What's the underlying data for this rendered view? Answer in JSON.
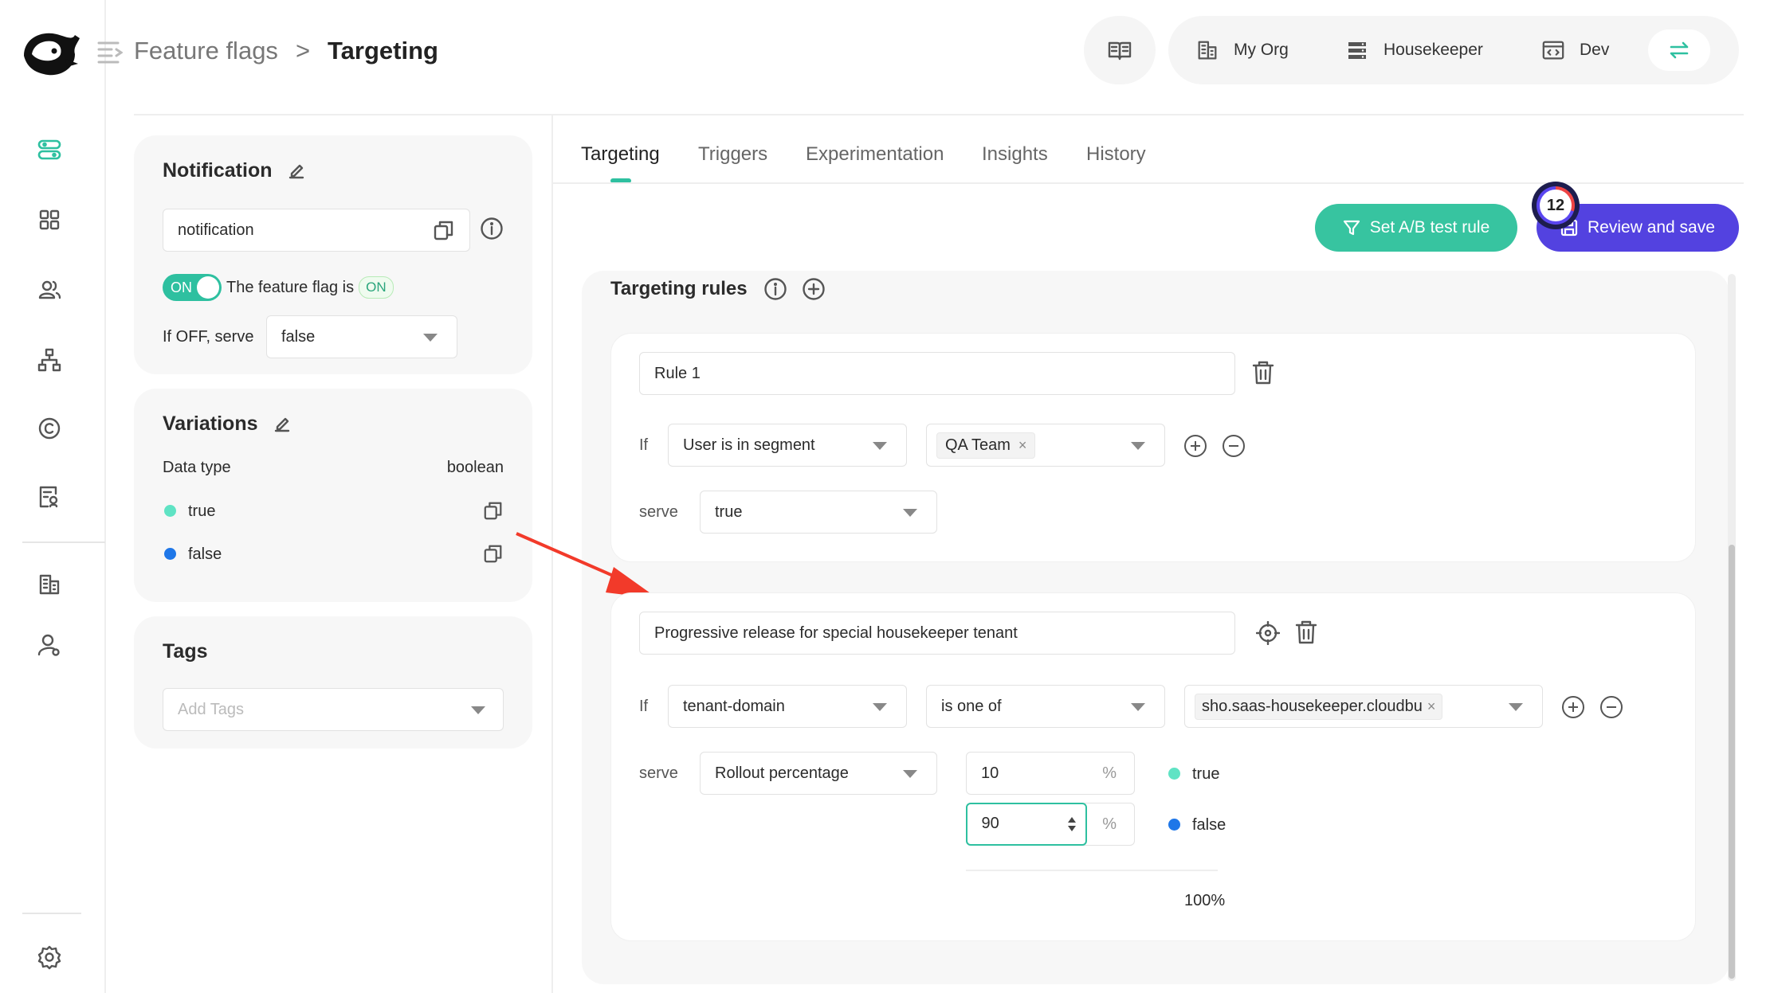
{
  "header": {
    "breadcrumb_parent": "Feature flags",
    "breadcrumb_sep": ">",
    "breadcrumb_current": "Targeting",
    "org": "My Org",
    "project": "Housekeeper",
    "environment": "Dev"
  },
  "sidebar": {
    "icons": [
      "toggle-icon",
      "grid-icon",
      "users-icon",
      "hierarchy-icon",
      "copyright-icon",
      "report-icon",
      "building-icon",
      "user-settings-icon",
      "settings-icon"
    ]
  },
  "notification_card": {
    "title": "Notification",
    "key_value": "notification",
    "toggle_label": "ON",
    "flag_text": "The feature flag is",
    "flag_status": "ON",
    "off_label": "If OFF, serve",
    "off_value": "false"
  },
  "variations_card": {
    "title": "Variations",
    "data_type_label": "Data type",
    "data_type_value": "boolean",
    "items": [
      {
        "label": "true",
        "color": "#5fe3c4"
      },
      {
        "label": "false",
        "color": "#1f77e8"
      }
    ]
  },
  "tags_card": {
    "title": "Tags",
    "placeholder": "Add Tags"
  },
  "tabs": [
    {
      "label": "Targeting",
      "active": true
    },
    {
      "label": "Triggers"
    },
    {
      "label": "Experimentation"
    },
    {
      "label": "Insights"
    },
    {
      "label": "History"
    }
  ],
  "actions": {
    "ab_button": "Set A/B test rule",
    "review_button": "Review and save",
    "badge_count": "12"
  },
  "targeting": {
    "title": "Targeting rules",
    "rule1": {
      "name": "Rule 1",
      "if_label": "If",
      "condition": "User is in segment",
      "segment_tag": "QA Team",
      "serve_label": "serve",
      "serve_value": "true"
    },
    "rule2": {
      "name": "Progressive release for special housekeeper tenant",
      "if_label": "If",
      "property": "tenant-domain",
      "operator": "is one of",
      "value_tag": "sho.saas-housekeeper.cloudbu",
      "serve_label": "serve",
      "serve_value": "Rollout percentage",
      "rollouts": [
        {
          "percent": "10",
          "unit": "%",
          "variation": "true"
        },
        {
          "percent": "90",
          "unit": "%",
          "variation": "false"
        }
      ],
      "total": "100%"
    }
  }
}
